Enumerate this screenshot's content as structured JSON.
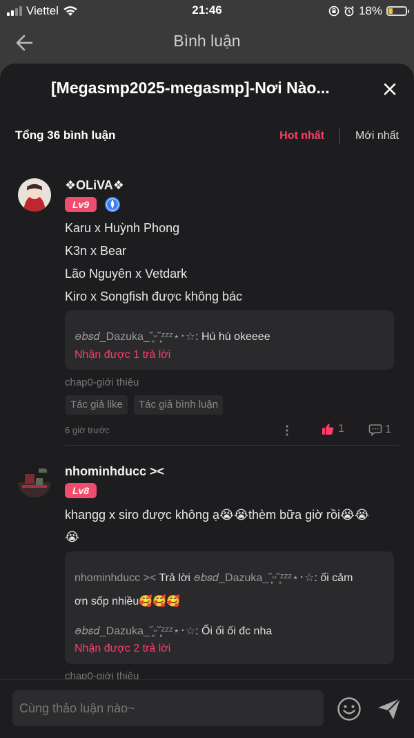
{
  "status_bar": {
    "carrier": "Viettel",
    "time": "21:46",
    "battery": "18%",
    "battery_level": 0.18
  },
  "header": {
    "title": "Bình luận"
  },
  "sheet": {
    "title": "[Megasmp2025-megasmp]-Nơi Nào...",
    "total_comments": "Tổng 36 bình luận",
    "sort": {
      "hot": "Hot nhất",
      "newest": "Mới nhất"
    }
  },
  "comments": [
    {
      "username": "❖OLiVA❖",
      "level": "Lv9",
      "lines": [
        "Karu x Huỳnh Phong",
        "K3n x Bear",
        "Lão Nguyên x Vetdark",
        "Kiro x Songfish được không bác"
      ],
      "reply_preview": {
        "name": "ꪮ𝑏𝑠𝑑_Dazuka_˘͈ᵕ˘͈ᶻᶻᶻ⋆･☆",
        "text": ": Hú hú okeeee"
      },
      "replies_link": "Nhận được 1 trả lời",
      "chapter": "chap0-giới thiệu",
      "tags": [
        "Tác giả like",
        "Tác giả bình luận"
      ],
      "time": "6 giờ trước",
      "likes": "1",
      "reply_count": "1"
    },
    {
      "username": "nhominhducc ><",
      "level": "Lv8",
      "line1": "khangg x siro được không ạ😭😭thèm bữa giờ rồi😭😭",
      "line2": "😭",
      "reply_preview": {
        "line1_name": "nhominhducc >< ",
        "line1_mid": "Trả lời ",
        "line1_target": "ꪮ𝑏𝑠𝑑_Dazuka_˘͈ᵕ˘͈ᶻᶻᶻ⋆･☆",
        "line1_text": ": ối cảm",
        "line2_text": "ơn sốp nhiều🥰🥰🥰",
        "line3_name": "ꪮ𝑏𝑠𝑑_Dazuka_˘͈ᵕ˘͈ᶻᶻᶻ⋆･☆",
        "line3_text": ": Ối ối ối đc nha"
      },
      "replies_link": "Nhận được 2 trả lời",
      "chapter": "chap0-giới thiệu"
    }
  ],
  "composer": {
    "placeholder": "Cùng thảo luận nào~"
  },
  "colors": {
    "accent": "#ff3d6b",
    "sheet_bg": "#1d1d1f",
    "panel_bg": "#2a2a2c"
  },
  "icons": [
    "signal-icon",
    "wifi-icon",
    "rotation-lock-icon",
    "alarm-icon",
    "battery-icon",
    "back-arrow-icon",
    "close-icon",
    "vip-badge-icon",
    "more-icon",
    "thumbs-up-icon",
    "comment-icon",
    "emoji-icon",
    "send-icon"
  ]
}
